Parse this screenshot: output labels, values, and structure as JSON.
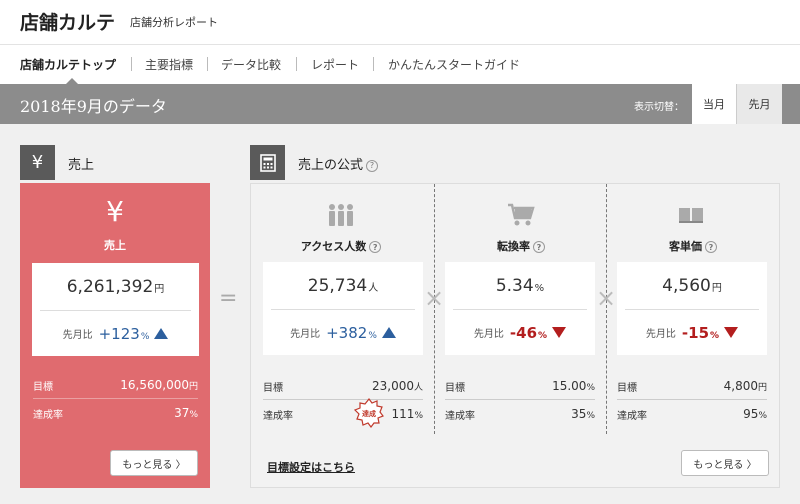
{
  "header": {
    "title": "店舗カルテ",
    "subtitle": "店舗分析レポート"
  },
  "nav": {
    "items": [
      "店舗カルテトップ",
      "主要指標",
      "データ比較",
      "レポート",
      "かんたんスタートガイド"
    ],
    "active_index": 0
  },
  "date_bar": {
    "title": "2018年9月のデータ",
    "toggle_label": "表示切替：",
    "toggle_current": "当月",
    "toggle_prev": "先月"
  },
  "sales": {
    "section_icon": "yen-icon",
    "section_title": "売上",
    "card_label": "売上",
    "value": "6,261,392",
    "unit": "円",
    "compare_label": "先月比",
    "compare_value": "+123",
    "compare_unit": "%",
    "target_label": "目標",
    "target_value": "16,560,000",
    "target_unit": "円",
    "achieve_label": "達成率",
    "achieve_value": "37",
    "achieve_unit": "%",
    "more_label": "もっと見る 〉"
  },
  "equals_sign": "=",
  "formula": {
    "section_icon": "calculator-icon",
    "section_title": "売上の公式",
    "help_icon": "question-icon",
    "times_sign": "×",
    "columns": [
      {
        "icon": "people-icon",
        "title": "アクセス人数",
        "value": "25,734",
        "unit": "人",
        "compare_label": "先月比",
        "compare_value": "+382",
        "compare_unit": "%",
        "direction": "up",
        "target_label": "目標",
        "target_value": "23,000",
        "target_unit": "人",
        "achieve_label": "達成率",
        "achieve_value": "111",
        "achieve_unit": "%",
        "badge": "達成"
      },
      {
        "icon": "cart-icon",
        "title": "転換率",
        "value": "5.34",
        "unit": "%",
        "compare_label": "先月比",
        "compare_value": "-46",
        "compare_unit": "%",
        "direction": "down",
        "target_label": "目標",
        "target_value": "15.00",
        "target_unit": "%",
        "achieve_label": "達成率",
        "achieve_value": "35",
        "achieve_unit": "%"
      },
      {
        "icon": "books-icon",
        "title": "客単価",
        "value": "4,560",
        "unit": "円",
        "compare_label": "先月比",
        "compare_value": "-15",
        "compare_unit": "%",
        "direction": "down",
        "target_label": "目標",
        "target_value": "4,800",
        "target_unit": "円",
        "achieve_label": "達成率",
        "achieve_value": "95",
        "achieve_unit": "%"
      }
    ],
    "target_link": "目標設定はこちら",
    "more_label": "もっと見る 〉"
  },
  "colors": {
    "sales_card": "#e06b6f",
    "up": "#2c5f9e",
    "down": "#b31e1e",
    "date_bar": "#8c8c8c"
  }
}
